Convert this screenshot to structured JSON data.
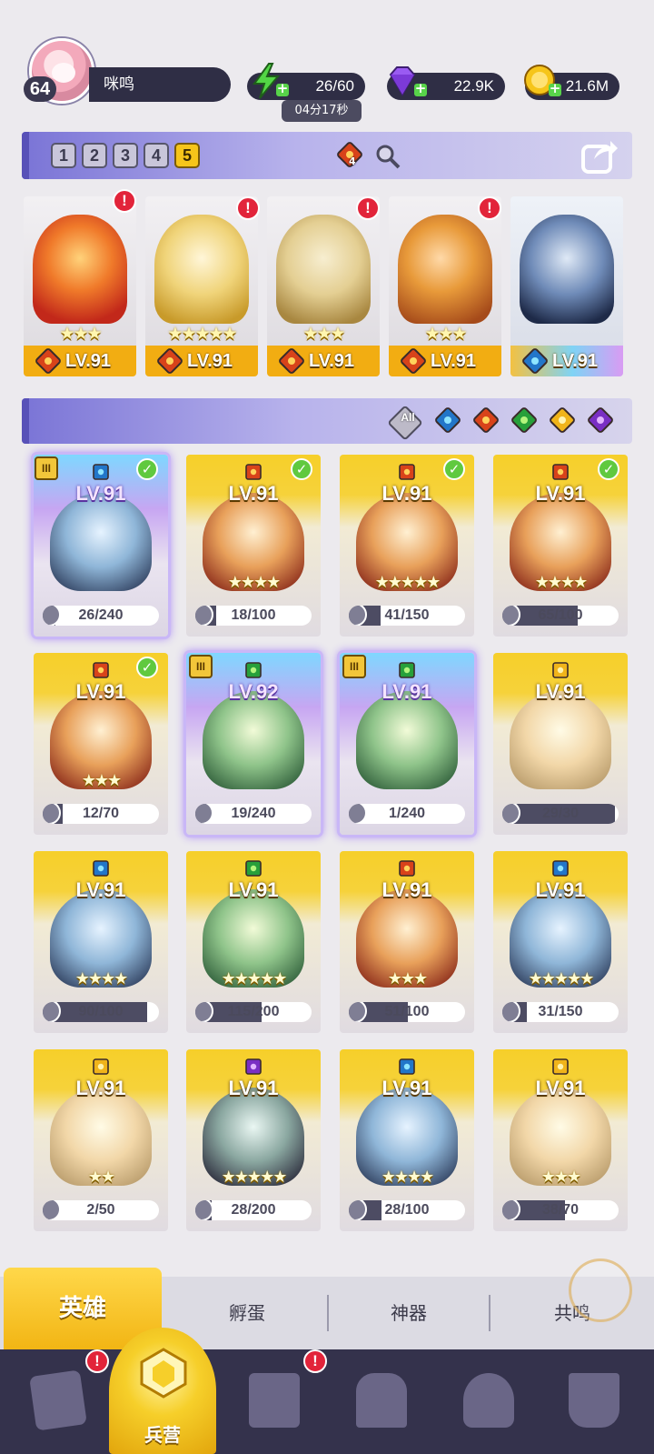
{
  "player": {
    "level": "64",
    "name": "咪鸣"
  },
  "resources": {
    "energy": "26/60",
    "energy_timer": "04分17秒",
    "gems": "22.9K",
    "gold": "21.6M"
  },
  "team_tabs": [
    "1",
    "2",
    "3",
    "4",
    "5"
  ],
  "active_team": "5",
  "team_bar": {
    "fire_count": "4"
  },
  "formation": [
    {
      "element": "fire",
      "stars": "★★★",
      "level": "LV.91"
    },
    {
      "element": "fire",
      "stars": "★★★★★",
      "level": "LV.91"
    },
    {
      "element": "fire",
      "stars": "★★★",
      "level": "LV.91"
    },
    {
      "element": "fire",
      "stars": "★★★",
      "level": "LV.91"
    },
    {
      "element": "water",
      "stars": "",
      "level": "LV.91"
    }
  ],
  "filters": {
    "all_label": "All",
    "elements": [
      "water",
      "fire",
      "wood",
      "light",
      "dark"
    ]
  },
  "heroes": [
    {
      "element": "water",
      "level": "LV.91",
      "shards": "26/240",
      "progress": 0.11,
      "stars": "",
      "epic": true
    },
    {
      "element": "fire",
      "level": "LV.91",
      "shards": "18/100",
      "progress": 0.18,
      "stars": "★★★★",
      "epic": false
    },
    {
      "element": "fire",
      "level": "LV.91",
      "shards": "41/150",
      "progress": 0.27,
      "stars": "★★★★★",
      "epic": false
    },
    {
      "element": "fire",
      "level": "LV.91",
      "shards": "65/100",
      "progress": 0.65,
      "stars": "★★★★",
      "epic": false
    },
    {
      "element": "fire",
      "level": "LV.91",
      "shards": "12/70",
      "progress": 0.17,
      "stars": "★★★",
      "epic": false
    },
    {
      "element": "wood",
      "level": "LV.92",
      "shards": "19/240",
      "progress": 0.08,
      "stars": "",
      "epic": true
    },
    {
      "element": "wood",
      "level": "LV.91",
      "shards": "1/240",
      "progress": 0.01,
      "stars": "",
      "epic": true
    },
    {
      "element": "light",
      "level": "LV.91",
      "shards": "29/30",
      "progress": 0.97,
      "stars": "",
      "epic": false
    },
    {
      "element": "water",
      "level": "LV.91",
      "shards": "90/100",
      "progress": 0.9,
      "stars": "★★★★",
      "epic": false
    },
    {
      "element": "wood",
      "level": "LV.91",
      "shards": "115/200",
      "progress": 0.57,
      "stars": "★★★★★",
      "epic": false
    },
    {
      "element": "fire",
      "level": "LV.91",
      "shards": "51/100",
      "progress": 0.51,
      "stars": "★★★",
      "epic": false
    },
    {
      "element": "water",
      "level": "LV.91",
      "shards": "31/150",
      "progress": 0.21,
      "stars": "★★★★★",
      "epic": false
    },
    {
      "element": "light",
      "level": "LV.91",
      "shards": "2/50",
      "progress": 0.04,
      "stars": "★★",
      "epic": false
    },
    {
      "element": "dark",
      "level": "LV.91",
      "shards": "28/200",
      "progress": 0.14,
      "stars": "★★★★★",
      "epic": false
    },
    {
      "element": "water",
      "level": "LV.91",
      "shards": "28/100",
      "progress": 0.28,
      "stars": "★★★★",
      "epic": false
    },
    {
      "element": "light",
      "level": "LV.91",
      "shards": "38/70",
      "progress": 0.54,
      "stars": "★★★",
      "epic": false
    }
  ],
  "sub_tabs": {
    "heroes": "英雄",
    "hatch": "孵蛋",
    "artifacts": "神器",
    "resonance": "共鸣"
  },
  "bottom_nav": {
    "barracks": "兵营"
  },
  "alert_mark": "!",
  "rank_mark": "III",
  "check_mark": "✓",
  "colors": {
    "gold": "#f2ad12",
    "bar": "#7a74d6",
    "nav": "#34324c",
    "alert": "#e2243a"
  }
}
